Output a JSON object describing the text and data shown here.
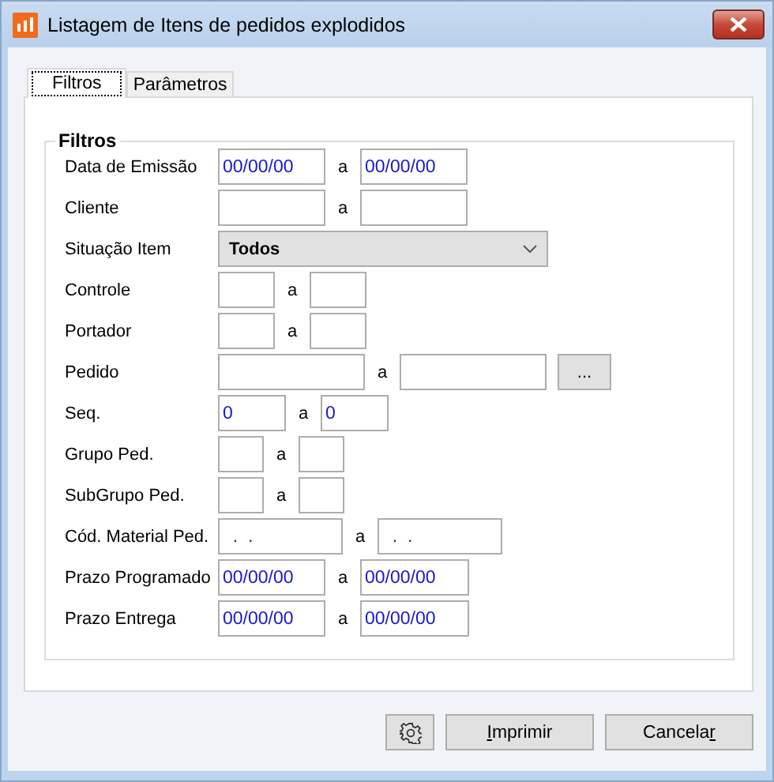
{
  "window": {
    "title": "Listagem de Itens de pedidos explodidos"
  },
  "tabs": [
    {
      "label": "Filtros",
      "selected": true
    },
    {
      "label": "Parâmetros",
      "selected": false
    }
  ],
  "group": {
    "title": "Filtros"
  },
  "rows": [
    {
      "label": "Data de Emissão",
      "kind": "date",
      "separator": "a",
      "from": "00/00/00",
      "to": "00/00/00"
    },
    {
      "label": "Cliente",
      "kind": "text",
      "separator": "a"
    },
    {
      "label": "Situação Item",
      "kind": "combo",
      "value": "Todos"
    },
    {
      "label": "Controle",
      "kind": "short",
      "separator": "a"
    },
    {
      "label": "Portador",
      "kind": "short",
      "separator": "a"
    },
    {
      "label": "Pedido",
      "kind": "long",
      "separator": "a",
      "button": "..."
    },
    {
      "label": "Seq.",
      "kind": "seq",
      "separator": "a",
      "from": "0",
      "to": "0"
    },
    {
      "label": "Grupo Ped.",
      "kind": "tiny",
      "separator": "a"
    },
    {
      "label": "SubGrupo Ped.",
      "kind": "tiny",
      "separator": "a"
    },
    {
      "label": "Cód. Material Ped.",
      "kind": "code",
      "separator": "a",
      "from": "  .  .",
      "to": "  .  ."
    },
    {
      "label": "Prazo Programado",
      "kind": "date",
      "separator": "a",
      "from": "00/00/00",
      "to": "00/00/00"
    },
    {
      "label": "Prazo Entrega",
      "kind": "date",
      "separator": "a",
      "from": "00/00/00",
      "to": "00/00/00"
    }
  ],
  "buttons": [
    {
      "label": [
        {
          "text": "I",
          "underlined": true
        },
        {
          "text": "mprimir",
          "underlined": false
        }
      ]
    },
    {
      "label": [
        {
          "text": "Cancela",
          "underlined": false
        },
        {
          "text": "r",
          "underlined": true
        }
      ]
    }
  ]
}
